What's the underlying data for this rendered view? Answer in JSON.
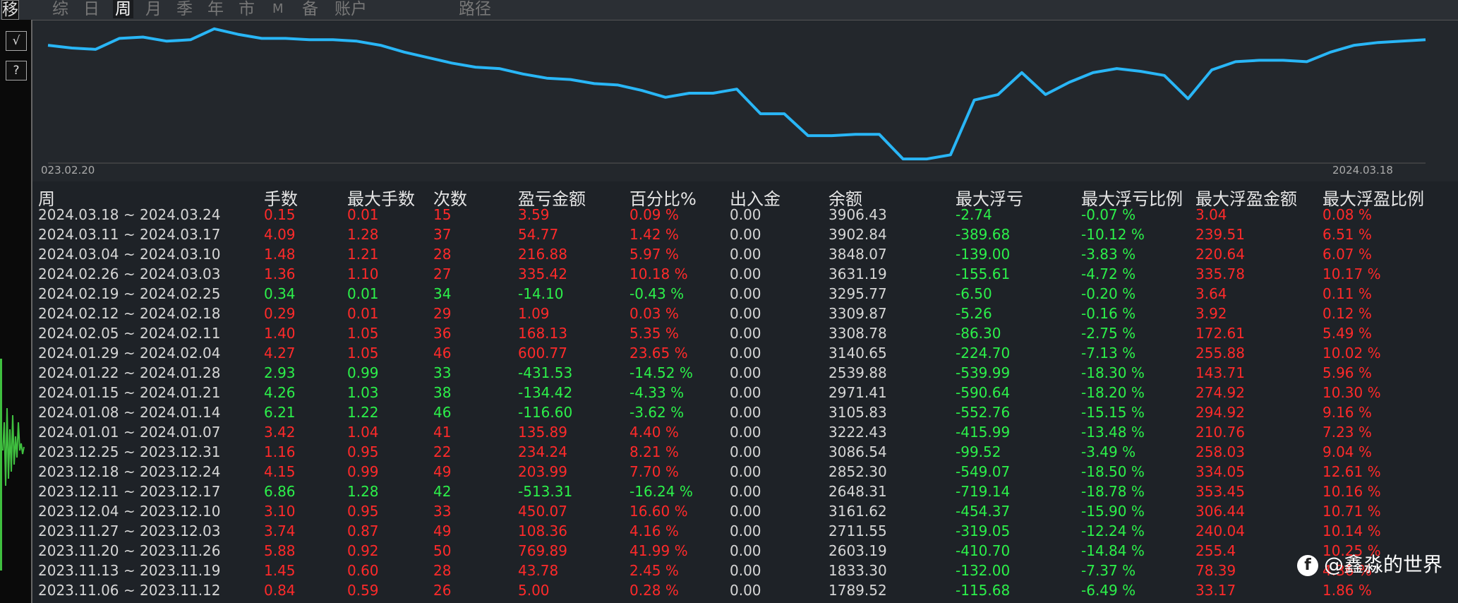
{
  "topbar": {
    "tabs": [
      "移",
      "综",
      "日",
      "周",
      "月",
      "季",
      "年",
      "市",
      "M",
      "备",
      "账户",
      "路径"
    ],
    "active": "周"
  },
  "side_buttons": [
    "√",
    "?"
  ],
  "chart": {
    "line_color": "#29b6f6",
    "x_start_label": "023.02.20",
    "x_end_label": "2024.03.18",
    "values": [
      0.85,
      0.83,
      0.82,
      0.9,
      0.91,
      0.88,
      0.89,
      0.97,
      0.93,
      0.9,
      0.9,
      0.89,
      0.89,
      0.88,
      0.85,
      0.8,
      0.76,
      0.72,
      0.69,
      0.68,
      0.64,
      0.61,
      0.6,
      0.57,
      0.56,
      0.52,
      0.47,
      0.5,
      0.5,
      0.53,
      0.35,
      0.35,
      0.19,
      0.19,
      0.2,
      0.2,
      0.02,
      0.02,
      0.05,
      0.45,
      0.49,
      0.65,
      0.49,
      0.58,
      0.65,
      0.68,
      0.66,
      0.63,
      0.46,
      0.67,
      0.73,
      0.74,
      0.74,
      0.73,
      0.8,
      0.85,
      0.87,
      0.88,
      0.89
    ]
  },
  "table": {
    "headers": [
      "周",
      "手数",
      "最大手数",
      "次数",
      "盈亏金额",
      "百分比%",
      "出入金",
      "余额",
      "最大浮亏",
      "最大浮亏比例",
      "最大浮盈金额",
      "最大浮盈比例"
    ],
    "rows": [
      {
        "week": "2024.03.18 ~ 2024.03.24",
        "lots": "0.15",
        "max_lots": "0.01",
        "count": "15",
        "pnl": "3.59",
        "pct": "0.09 %",
        "flow": "0.00",
        "balance": "3906.43",
        "max_loss": "-2.74",
        "max_loss_pct": "-0.07 %",
        "max_gain": "3.04",
        "max_gain_pct": "0.08 %",
        "sign": "pos"
      },
      {
        "week": "2024.03.11 ~ 2024.03.17",
        "lots": "4.09",
        "max_lots": "1.28",
        "count": "37",
        "pnl": "54.77",
        "pct": "1.42 %",
        "flow": "0.00",
        "balance": "3902.84",
        "max_loss": "-389.68",
        "max_loss_pct": "-10.12 %",
        "max_gain": "239.51",
        "max_gain_pct": "6.51 %",
        "sign": "pos"
      },
      {
        "week": "2024.03.04 ~ 2024.03.10",
        "lots": "1.48",
        "max_lots": "1.21",
        "count": "28",
        "pnl": "216.88",
        "pct": "5.97 %",
        "flow": "0.00",
        "balance": "3848.07",
        "max_loss": "-139.00",
        "max_loss_pct": "-3.83 %",
        "max_gain": "220.64",
        "max_gain_pct": "6.07 %",
        "sign": "pos"
      },
      {
        "week": "2024.02.26 ~ 2024.03.03",
        "lots": "1.36",
        "max_lots": "1.10",
        "count": "27",
        "pnl": "335.42",
        "pct": "10.18 %",
        "flow": "0.00",
        "balance": "3631.19",
        "max_loss": "-155.61",
        "max_loss_pct": "-4.72 %",
        "max_gain": "335.78",
        "max_gain_pct": "10.17 %",
        "sign": "pos"
      },
      {
        "week": "2024.02.19 ~ 2024.02.25",
        "lots": "0.34",
        "max_lots": "0.01",
        "count": "34",
        "pnl": "-14.10",
        "pct": "-0.43 %",
        "flow": "0.00",
        "balance": "3295.77",
        "max_loss": "-6.50",
        "max_loss_pct": "-0.20 %",
        "max_gain": "3.64",
        "max_gain_pct": "0.11 %",
        "sign": "neg"
      },
      {
        "week": "2024.02.12 ~ 2024.02.18",
        "lots": "0.29",
        "max_lots": "0.01",
        "count": "29",
        "pnl": "1.09",
        "pct": "0.03 %",
        "flow": "0.00",
        "balance": "3309.87",
        "max_loss": "-5.26",
        "max_loss_pct": "-0.16 %",
        "max_gain": "3.92",
        "max_gain_pct": "0.12 %",
        "sign": "pos"
      },
      {
        "week": "2024.02.05 ~ 2024.02.11",
        "lots": "1.40",
        "max_lots": "1.05",
        "count": "36",
        "pnl": "168.13",
        "pct": "5.35 %",
        "flow": "0.00",
        "balance": "3308.78",
        "max_loss": "-86.30",
        "max_loss_pct": "-2.75 %",
        "max_gain": "172.61",
        "max_gain_pct": "5.49 %",
        "sign": "pos"
      },
      {
        "week": "2024.01.29 ~ 2024.02.04",
        "lots": "4.27",
        "max_lots": "1.05",
        "count": "46",
        "pnl": "600.77",
        "pct": "23.65 %",
        "flow": "0.00",
        "balance": "3140.65",
        "max_loss": "-224.70",
        "max_loss_pct": "-7.13 %",
        "max_gain": "255.88",
        "max_gain_pct": "10.02 %",
        "sign": "pos"
      },
      {
        "week": "2024.01.22 ~ 2024.01.28",
        "lots": "2.93",
        "max_lots": "0.99",
        "count": "33",
        "pnl": "-431.53",
        "pct": "-14.52 %",
        "flow": "0.00",
        "balance": "2539.88",
        "max_loss": "-539.99",
        "max_loss_pct": "-18.30 %",
        "max_gain": "143.71",
        "max_gain_pct": "5.96 %",
        "sign": "neg"
      },
      {
        "week": "2024.01.15 ~ 2024.01.21",
        "lots": "4.26",
        "max_lots": "1.03",
        "count": "38",
        "pnl": "-134.42",
        "pct": "-4.33 %",
        "flow": "0.00",
        "balance": "2971.41",
        "max_loss": "-590.64",
        "max_loss_pct": "-18.20 %",
        "max_gain": "274.92",
        "max_gain_pct": "10.30 %",
        "sign": "neg"
      },
      {
        "week": "2024.01.08 ~ 2024.01.14",
        "lots": "6.21",
        "max_lots": "1.22",
        "count": "46",
        "pnl": "-116.60",
        "pct": "-3.62 %",
        "flow": "0.00",
        "balance": "3105.83",
        "max_loss": "-552.76",
        "max_loss_pct": "-15.15 %",
        "max_gain": "294.92",
        "max_gain_pct": "9.16 %",
        "sign": "neg"
      },
      {
        "week": "2024.01.01 ~ 2024.01.07",
        "lots": "3.42",
        "max_lots": "1.04",
        "count": "41",
        "pnl": "135.89",
        "pct": "4.40 %",
        "flow": "0.00",
        "balance": "3222.43",
        "max_loss": "-415.99",
        "max_loss_pct": "-13.48 %",
        "max_gain": "210.76",
        "max_gain_pct": "7.23 %",
        "sign": "pos"
      },
      {
        "week": "2023.12.25 ~ 2023.12.31",
        "lots": "1.16",
        "max_lots": "0.95",
        "count": "22",
        "pnl": "234.24",
        "pct": "8.21 %",
        "flow": "0.00",
        "balance": "3086.54",
        "max_loss": "-99.52",
        "max_loss_pct": "-3.49 %",
        "max_gain": "258.03",
        "max_gain_pct": "9.04 %",
        "sign": "pos"
      },
      {
        "week": "2023.12.18 ~ 2023.12.24",
        "lots": "4.15",
        "max_lots": "0.99",
        "count": "49",
        "pnl": "203.99",
        "pct": "7.70 %",
        "flow": "0.00",
        "balance": "2852.30",
        "max_loss": "-549.07",
        "max_loss_pct": "-18.50 %",
        "max_gain": "334.05",
        "max_gain_pct": "12.61 %",
        "sign": "pos"
      },
      {
        "week": "2023.12.11 ~ 2023.12.17",
        "lots": "6.86",
        "max_lots": "1.28",
        "count": "42",
        "pnl": "-513.31",
        "pct": "-16.24 %",
        "flow": "0.00",
        "balance": "2648.31",
        "max_loss": "-719.14",
        "max_loss_pct": "-18.78 %",
        "max_gain": "353.45",
        "max_gain_pct": "10.16 %",
        "sign": "neg"
      },
      {
        "week": "2023.12.04 ~ 2023.12.10",
        "lots": "3.10",
        "max_lots": "0.95",
        "count": "33",
        "pnl": "450.07",
        "pct": "16.60 %",
        "flow": "0.00",
        "balance": "3161.62",
        "max_loss": "-454.37",
        "max_loss_pct": "-15.90 %",
        "max_gain": "306.44",
        "max_gain_pct": "10.71 %",
        "sign": "pos"
      },
      {
        "week": "2023.11.27 ~ 2023.12.03",
        "lots": "3.74",
        "max_lots": "0.87",
        "count": "49",
        "pnl": "108.36",
        "pct": "4.16 %",
        "flow": "0.00",
        "balance": "2711.55",
        "max_loss": "-319.05",
        "max_loss_pct": "-12.24 %",
        "max_gain": "240.04",
        "max_gain_pct": "10.14 %",
        "sign": "pos"
      },
      {
        "week": "2023.11.20 ~ 2023.11.26",
        "lots": "5.88",
        "max_lots": "0.92",
        "count": "50",
        "pnl": "769.89",
        "pct": "41.99 %",
        "flow": "0.00",
        "balance": "2603.19",
        "max_loss": "-410.70",
        "max_loss_pct": "-14.84 %",
        "max_gain": "255.4",
        "max_gain_pct": "10.25 %",
        "sign": "pos"
      },
      {
        "week": "2023.11.13 ~ 2023.11.19",
        "lots": "1.45",
        "max_lots": "0.60",
        "count": "28",
        "pnl": "43.78",
        "pct": "2.45 %",
        "flow": "0.00",
        "balance": "1833.30",
        "max_loss": "-132.00",
        "max_loss_pct": "-7.37 %",
        "max_gain": "78.39",
        "max_gain_pct": "4.36 %",
        "sign": "pos"
      },
      {
        "week": "2023.11.06 ~ 2023.11.12",
        "lots": "0.84",
        "max_lots": "0.59",
        "count": "26",
        "pnl": "5.00",
        "pct": "0.28 %",
        "flow": "0.00",
        "balance": "1789.52",
        "max_loss": "-115.68",
        "max_loss_pct": "-6.49 %",
        "max_gain": "33.17",
        "max_gain_pct": "1.86 %",
        "sign": "pos"
      }
    ]
  },
  "watermark": {
    "icon": "f",
    "text": "@鑫淼的世界"
  }
}
